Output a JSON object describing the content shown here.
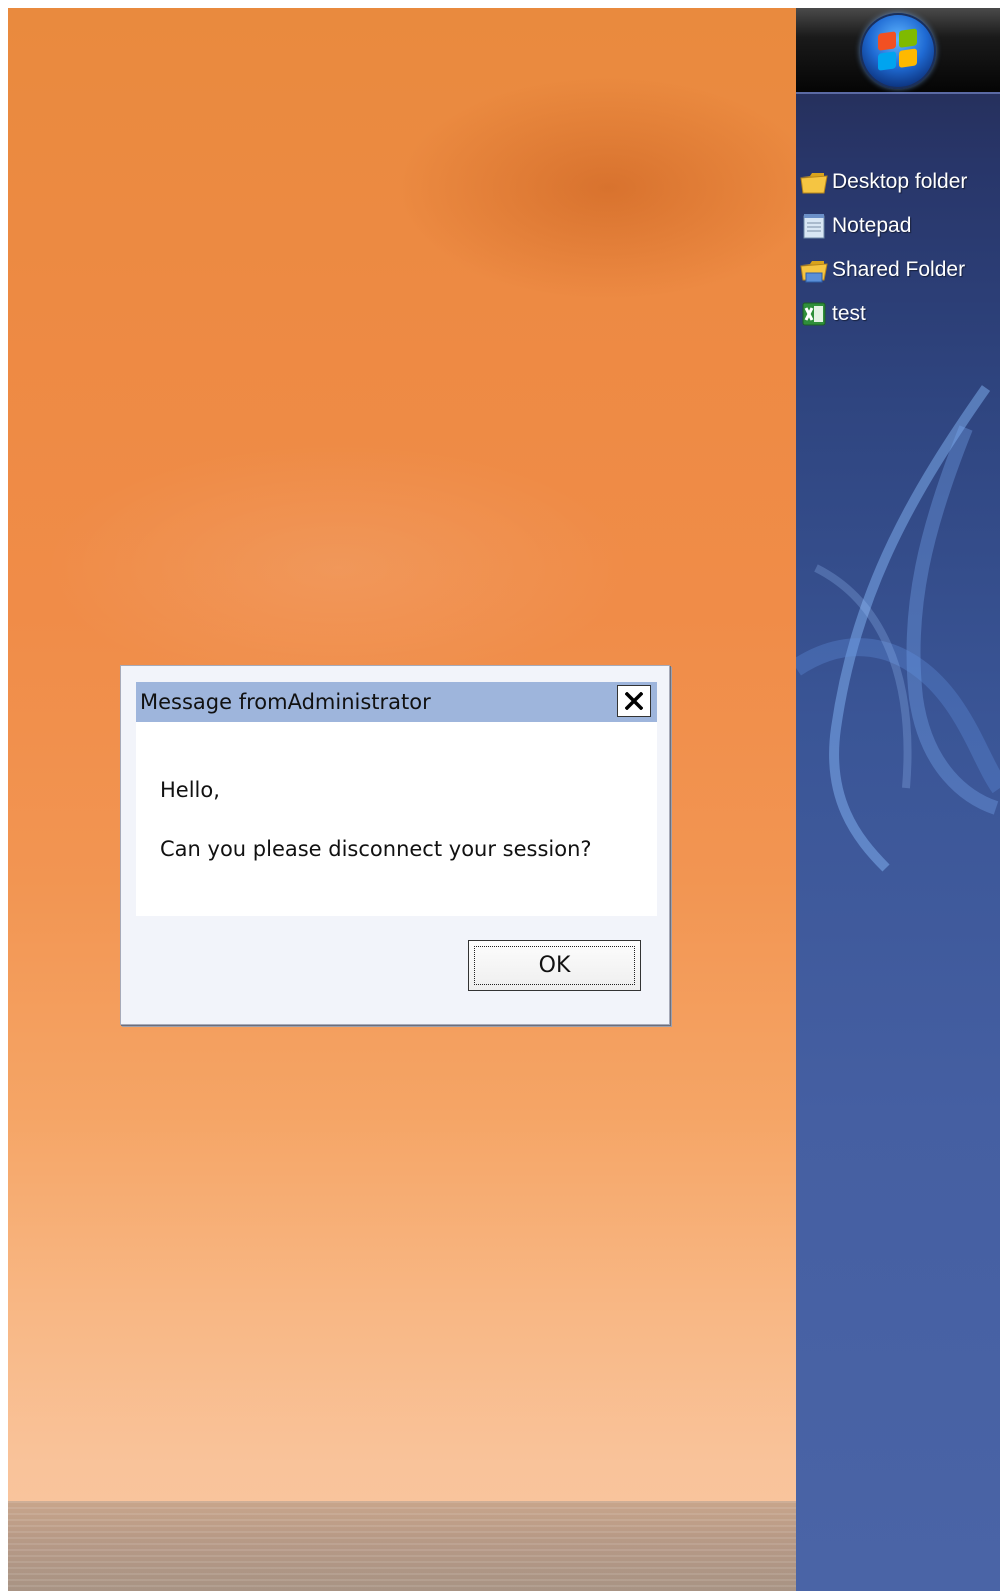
{
  "desktop": {
    "shortcuts": [
      {
        "label": "Desktop folder",
        "icon": "folder-icon"
      },
      {
        "label": "Notepad",
        "icon": "notepad-icon"
      },
      {
        "label": "Shared Folder",
        "icon": "shared-folder-icon"
      },
      {
        "label": "test",
        "icon": "excel-icon"
      }
    ]
  },
  "start_orb": {
    "icon": "windows-logo-icon"
  },
  "dialog": {
    "title": "Message fromAdministrator",
    "close_icon": "close-icon",
    "lines": [
      "Hello,",
      "Can you please disconnect your session?"
    ],
    "ok_label": "OK"
  },
  "colors": {
    "titlebar": "#9eb5dc",
    "panel": "#3a5596",
    "wallpaper": "#f08c48"
  }
}
